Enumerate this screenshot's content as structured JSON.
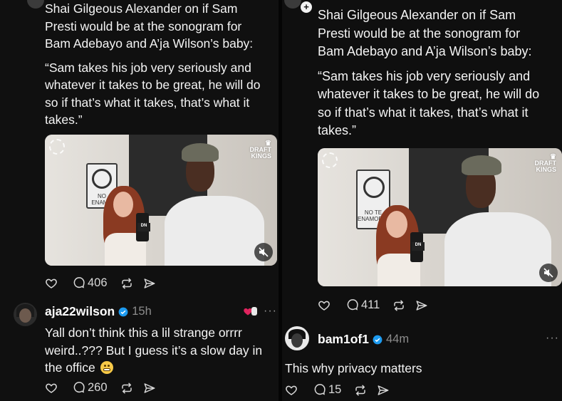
{
  "colors": {
    "background": "#101010",
    "text": "#f4f4f4",
    "muted": "#8c8c8c",
    "verified": "#1d9bf0",
    "heart_red": "#e0245e"
  },
  "left": {
    "post": {
      "line1": "Shai Gilgeous Alexander on if Sam",
      "line2": "Presti would be at the sonogram for",
      "line3": "Bam Adebayo and A’ja Wilson’s baby:",
      "quote1": "“Sam takes his job very seriously and",
      "quote2": "whatever it takes to be great, he will do",
      "quote3": "so if that’s what it takes, that’s what it",
      "quote4": "takes.”"
    },
    "video": {
      "logo_line1": "DRAFT",
      "logo_line2": "KINGS",
      "sign_line1": "NO",
      "sign_line2": "ENAMO",
      "mic_flag": "DN"
    },
    "actions": {
      "likes_icon": "heart-icon",
      "replies": "406",
      "repost_icon": "repost-icon",
      "share_icon": "share-icon"
    },
    "reply": {
      "handle": "aja22wilson",
      "time": "15h",
      "line1": "Yall don’t think this a lil strange orrrr",
      "line2": "weird..??? But I guess it’s a slow day in",
      "line3": "the office",
      "emoji": "grimacing-face",
      "more": "···",
      "replies": "260"
    }
  },
  "right": {
    "post": {
      "line1": "Shai Gilgeous Alexander on if Sam",
      "line2": "Presti would be at the sonogram for",
      "line3": "Bam Adebayo and A’ja Wilson’s baby:",
      "quote1": "“Sam takes his job very seriously and",
      "quote2": "whatever it takes to be great, he will do",
      "quote3": "so if that’s what it takes, that’s what it",
      "quote4": "takes.”"
    },
    "video": {
      "logo_line1": "DRAFT",
      "logo_line2": "KINGS",
      "sign_line1": "NO TE",
      "sign_line2": "ENAMORES",
      "mic_flag": "DN"
    },
    "actions": {
      "replies": "411"
    },
    "reply": {
      "handle": "bam1of1",
      "time": "44m",
      "text": "This why privacy matters",
      "more": "···",
      "replies": "15"
    }
  }
}
